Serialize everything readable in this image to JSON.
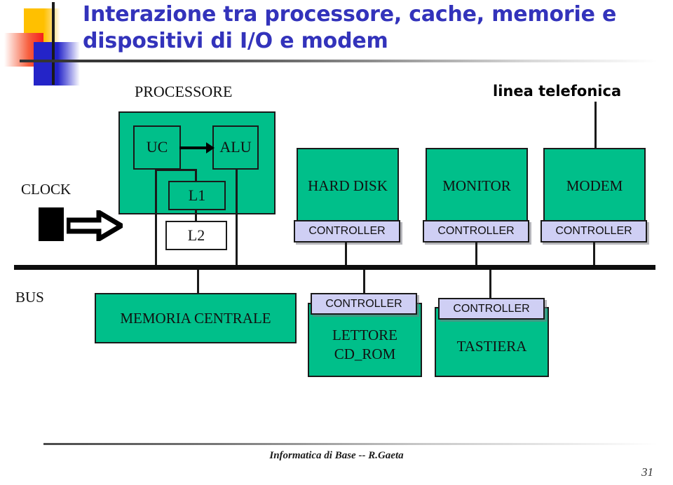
{
  "slide": {
    "title": "Interazione tra processore, cache, memorie e dispositivi di I/O e modem",
    "title_color": "#3333bb",
    "page_number": "31",
    "footer": "Informatica di Base -- R.Gaeta"
  },
  "palette": {
    "device_green": "#00bf8a",
    "controller_lavender": "#cfcff4",
    "line_black": "#1a1a1a",
    "logo_yellow": "#ffc000",
    "logo_red": "#f51e1e",
    "logo_blue": "#2424c8"
  },
  "diagram": {
    "processor_label": "PROCESSORE",
    "phone_line_label": "linea telefonica",
    "clock_label": "CLOCK",
    "bus_label": "BUS",
    "cpu_units": [
      {
        "id": "uc",
        "label": "UC"
      },
      {
        "id": "alu",
        "label": "ALU"
      }
    ],
    "caches": [
      {
        "id": "l1",
        "label": "L1"
      },
      {
        "id": "l2",
        "label": "L2"
      }
    ],
    "top_devices": [
      {
        "id": "hard-disk",
        "label": "HARD DISK",
        "controller": "CONTROLLER"
      },
      {
        "id": "monitor",
        "label": "MONITOR",
        "controller": "CONTROLLER"
      },
      {
        "id": "modem",
        "label": "MODEM",
        "controller": "CONTROLLER"
      }
    ],
    "memory": {
      "id": "memoria-centrale",
      "label": "MEMORIA CENTRALE"
    },
    "bottom_devices": [
      {
        "id": "lettore-cd-rom",
        "label_line1": "LETTORE",
        "label_line2": "CD_ROM",
        "controller": "CONTROLLER"
      },
      {
        "id": "tastiera",
        "label_line1": "TASTIERA",
        "label_line2": "",
        "controller": "CONTROLLER"
      }
    ]
  }
}
